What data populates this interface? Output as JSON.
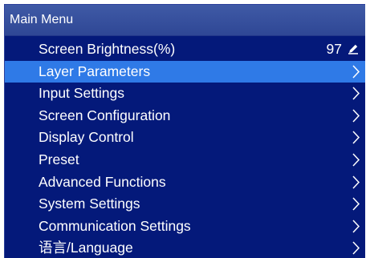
{
  "header": {
    "title": "Main Menu"
  },
  "menu": {
    "items": [
      {
        "label": "Screen Brightness(%)",
        "value": "97",
        "icon": "edit-icon",
        "selected": false
      },
      {
        "label": "Layer Parameters",
        "icon": "chevron-right-icon",
        "selected": true
      },
      {
        "label": "Input Settings",
        "icon": "chevron-right-icon",
        "selected": false
      },
      {
        "label": "Screen Configuration",
        "icon": "chevron-right-icon",
        "selected": false
      },
      {
        "label": "Display Control",
        "icon": "chevron-right-icon",
        "selected": false
      },
      {
        "label": "Preset",
        "icon": "chevron-right-icon",
        "selected": false
      },
      {
        "label": "Advanced Functions",
        "icon": "chevron-right-icon",
        "selected": false
      },
      {
        "label": "System Settings",
        "icon": "chevron-right-icon",
        "selected": false
      },
      {
        "label": "Communication Settings",
        "icon": "chevron-right-icon",
        "selected": false
      },
      {
        "label": "语言/Language",
        "icon": "chevron-right-icon",
        "selected": false
      }
    ]
  },
  "colors": {
    "background": "#04197a",
    "header": "#3f5aa6",
    "selected_row": "#2f7ae7",
    "text": "#ffffff"
  }
}
